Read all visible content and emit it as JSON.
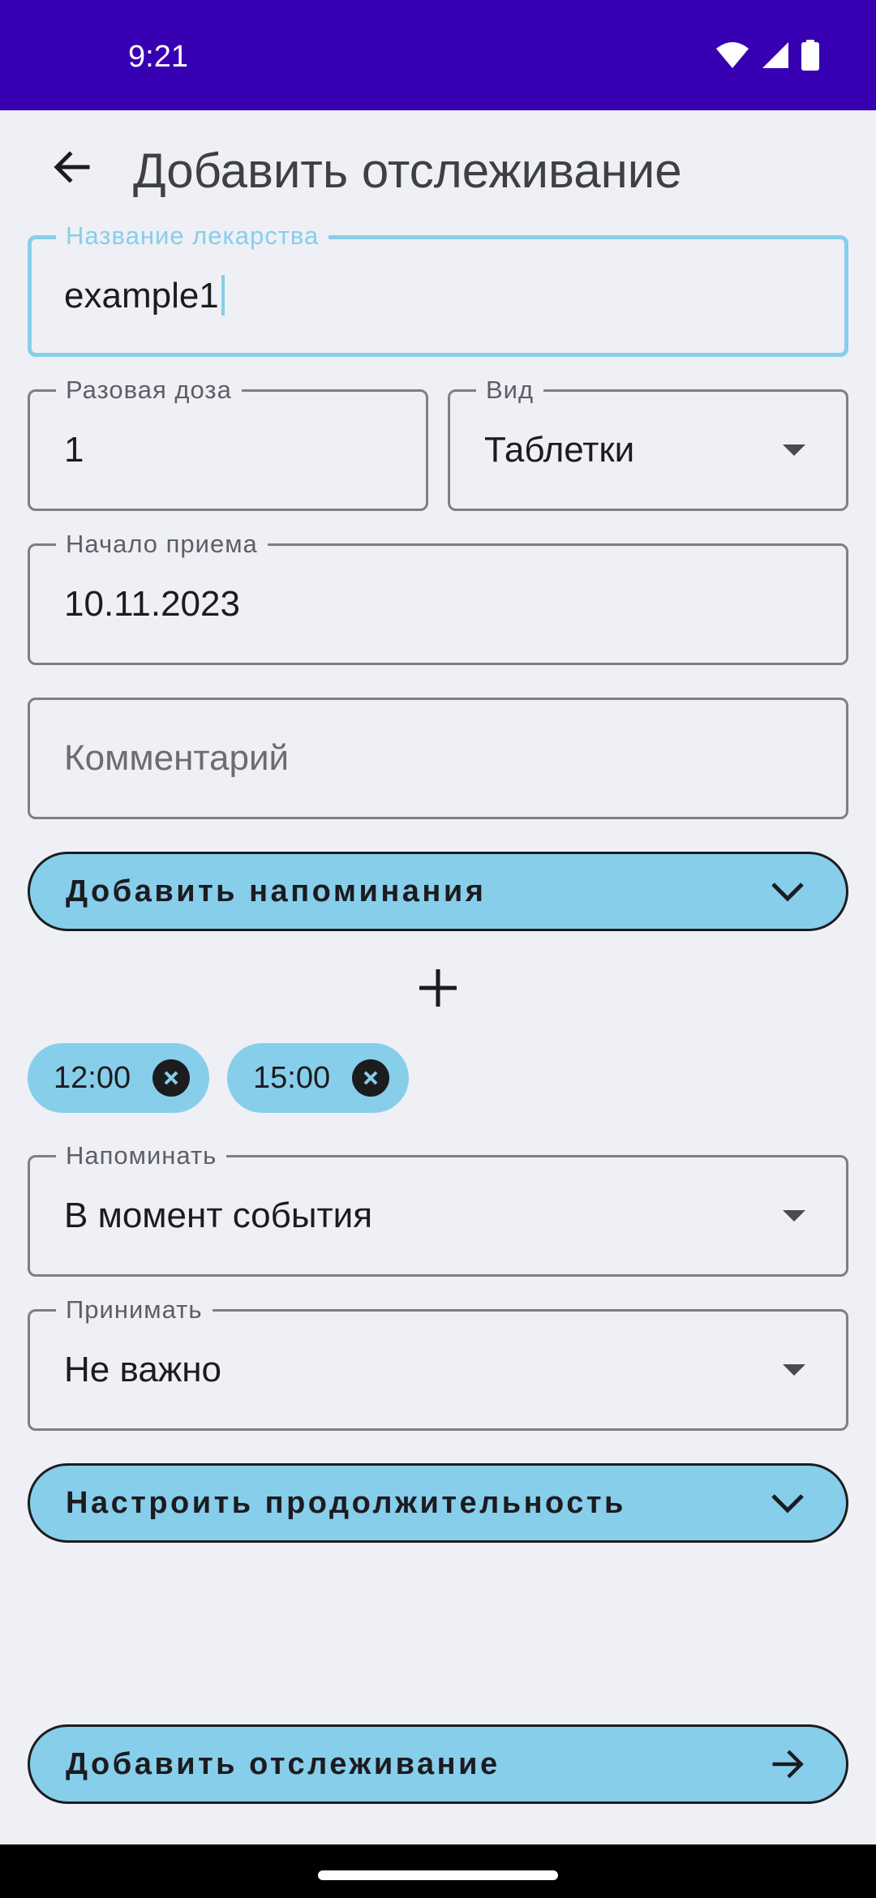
{
  "status_bar": {
    "time": "9:21",
    "icons": [
      "wifi-icon",
      "signal-icon",
      "battery-icon"
    ]
  },
  "app_bar": {
    "back_icon": "arrow-back-icon",
    "title": "Добавить отслеживание"
  },
  "form": {
    "drug_name": {
      "label": "Название лекарства",
      "value": "example1"
    },
    "dose": {
      "label": "Разовая доза",
      "value": "1"
    },
    "kind": {
      "label": "Вид",
      "value": "Таблетки"
    },
    "start_date": {
      "label": "Начало приема",
      "value": "10.11.2023"
    },
    "comment": {
      "placeholder": "Комментарий"
    },
    "reminders_button": {
      "label": "Добавить напоминания",
      "icon": "chevron-down-icon"
    },
    "add_reminder_icon": "plus-icon",
    "reminder_chips": [
      {
        "time": "12:00",
        "remove_icon": "cancel-icon"
      },
      {
        "time": "15:00",
        "remove_icon": "cancel-icon"
      }
    ],
    "remind": {
      "label": "Напоминать",
      "value": "В момент события"
    },
    "take": {
      "label": "Принимать",
      "value": "Не важно"
    },
    "duration_button": {
      "label": "Настроить продолжительность",
      "icon": "chevron-down-icon"
    }
  },
  "submit_button": {
    "label": "Добавить отслеживание",
    "icon": "arrow-forward-icon"
  },
  "colors": {
    "status_bar": "#3700B3",
    "background": "#EEF0F5",
    "accent": "#87CEEB",
    "outline": "#7E7E84",
    "text": "#1C1B1F"
  }
}
